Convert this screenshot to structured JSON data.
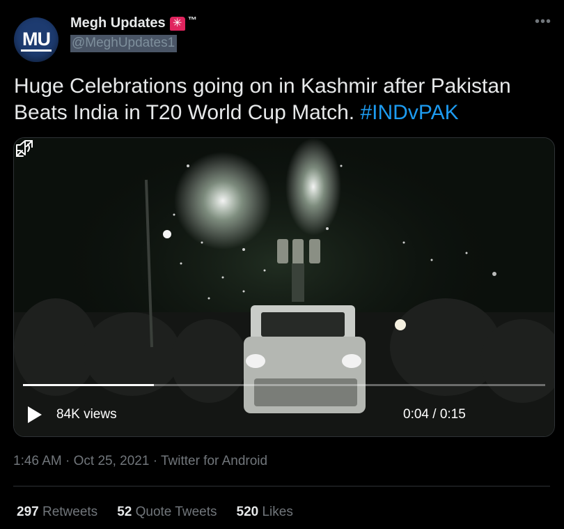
{
  "author": {
    "avatar_text": "MU",
    "display_name": "Megh Updates",
    "trademark": "™",
    "handle": "@MeghUpdates1"
  },
  "more_icon": "•••",
  "tweet": {
    "text": "Huge Celebrations going on in Kashmir after Pakistan Beats India in T20 World Cup Match. ",
    "hashtag": "#INDvPAK"
  },
  "video": {
    "views": "84K views",
    "time": "0:04 / 0:15",
    "progress": 0.25,
    "icons": [
      "play-icon",
      "volume-icon",
      "expand-icon"
    ]
  },
  "meta": {
    "time": "1:46 AM",
    "date": "Oct 25, 2021",
    "source": "Twitter for Android",
    "separator": "·"
  },
  "stats": [
    {
      "count": "297",
      "label": "Retweets"
    },
    {
      "count": "52",
      "label": "Quote Tweets"
    },
    {
      "count": "520",
      "label": "Likes"
    }
  ],
  "colors": {
    "background": "#000000",
    "text": "#e7e9ea",
    "secondary": "#71767b",
    "link": "#1d9bf0"
  }
}
